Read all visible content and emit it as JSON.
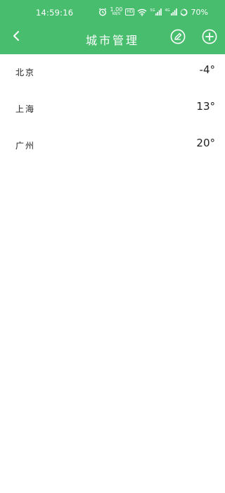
{
  "status_bar": {
    "time": "14:59:16",
    "net_speed": "1.00",
    "net_unit": "KB/S",
    "hd_badge": "HD",
    "signal_badge_1": "5G",
    "signal_badge_2": "4G",
    "battery_percent": "70%",
    "icons": [
      "alarm-icon",
      "wifi-icon",
      "signal-icon",
      "battery-icon"
    ]
  },
  "toolbar": {
    "title": "城市管理",
    "icons": [
      "back-arrow-icon",
      "edit-icon",
      "add-icon"
    ]
  },
  "cities": [
    {
      "name": "北京",
      "temperature": "-4°"
    },
    {
      "name": "上海",
      "temperature": "13°"
    },
    {
      "name": "广州",
      "temperature": "20°"
    }
  ],
  "colors": {
    "accent": "#48bd6e",
    "background": "#ffffff",
    "text": "#222222"
  }
}
